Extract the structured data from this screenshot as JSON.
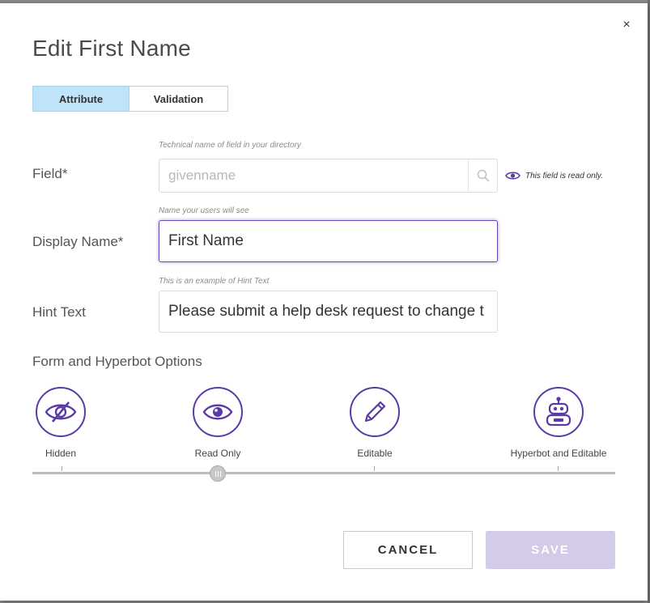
{
  "dialog": {
    "title": "Edit First Name",
    "close_label": "×"
  },
  "tabs": [
    {
      "label": "Attribute",
      "active": true
    },
    {
      "label": "Validation",
      "active": false
    }
  ],
  "fields": {
    "field": {
      "label": "Field*",
      "hint": "Technical name of field in your directory",
      "value": "givenname",
      "readonly_note": "This field is read only."
    },
    "display_name": {
      "label": "Display Name*",
      "hint": "Name your users will see",
      "value": "First Name"
    },
    "hint_text": {
      "label": "Hint Text",
      "hint": "This is an example of Hint Text",
      "value": "Please submit a help desk request to change t"
    }
  },
  "options": {
    "section_title": "Form and Hyperbot Options",
    "items": [
      {
        "label": "Hidden",
        "icon": "eye-slash-icon"
      },
      {
        "label": "Read Only",
        "icon": "eye-icon"
      },
      {
        "label": "Editable",
        "icon": "pencil-icon"
      },
      {
        "label": "Hyperbot and Editable",
        "icon": "robot-icon"
      }
    ],
    "selected": "Read Only"
  },
  "buttons": {
    "cancel": "CANCEL",
    "save": "SAVE"
  },
  "colors": {
    "accent": "#5b3aa7",
    "tab_active": "#bfe3f9",
    "save_disabled": "#d4cbe9"
  }
}
